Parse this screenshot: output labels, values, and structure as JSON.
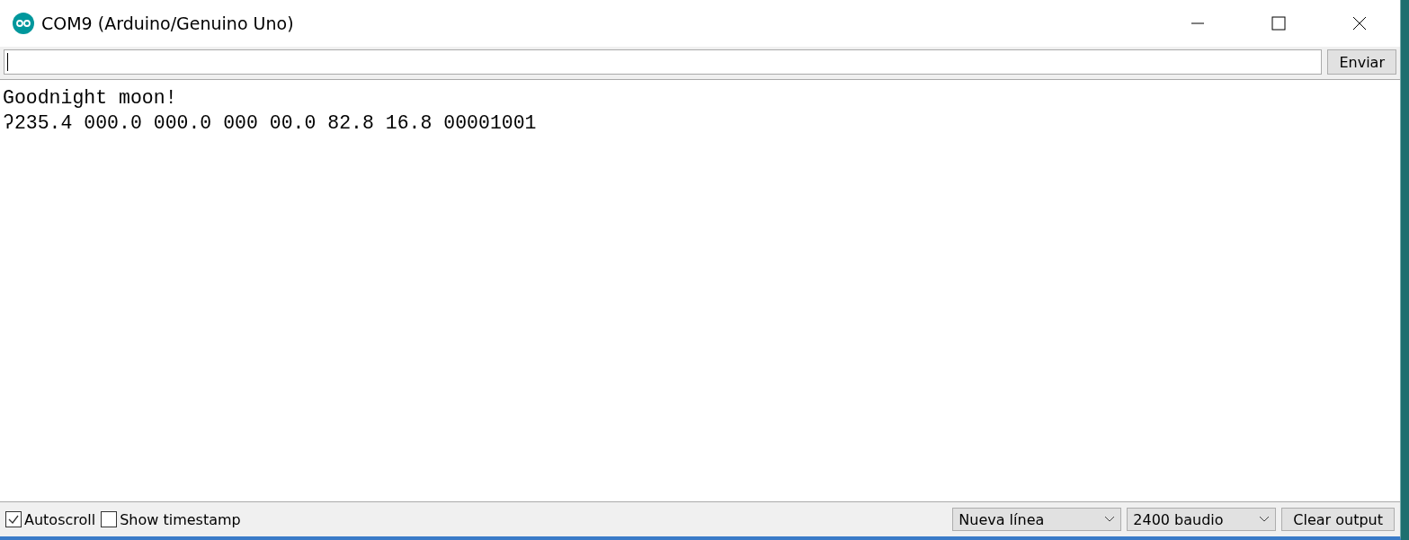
{
  "window": {
    "title": "COM9 (Arduino/Genuino Uno)"
  },
  "send": {
    "button": "Enviar"
  },
  "output": {
    "lines": [
      "Goodnight moon!",
      "ʔ235.4 000.0 000.0 000 00.0 82.8 16.8 00001001"
    ]
  },
  "footer": {
    "checkboxes": [
      {
        "label": "Autoscroll",
        "checked": true
      },
      {
        "label": "Show timestamp",
        "checked": false
      }
    ],
    "line_ending": "Nueva línea",
    "baud_rate": "2400 baudio",
    "clear_button": "Clear output"
  }
}
